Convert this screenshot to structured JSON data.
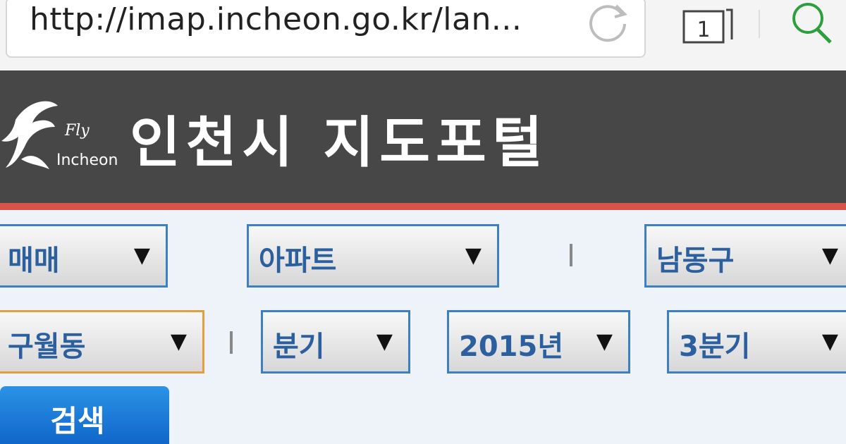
{
  "browser": {
    "url": "http://imap.incheon.go.kr/lan...",
    "tab_count": "1"
  },
  "header": {
    "title": "인천시 지도포털",
    "logo_text": "Fly Incheon"
  },
  "filters": {
    "trade_type": "매매",
    "building_type": "아파트",
    "district": "남동구",
    "neighborhood": "구월동",
    "period_type": "분기",
    "year": "2015년",
    "quarter": "3분기"
  },
  "search_label": "검색",
  "colors": {
    "banner": "#474747",
    "accent_red": "#d9534a",
    "select_border": "#3d7fbf",
    "select_text": "#2b5f9e",
    "search_button": "#1a78d6"
  }
}
